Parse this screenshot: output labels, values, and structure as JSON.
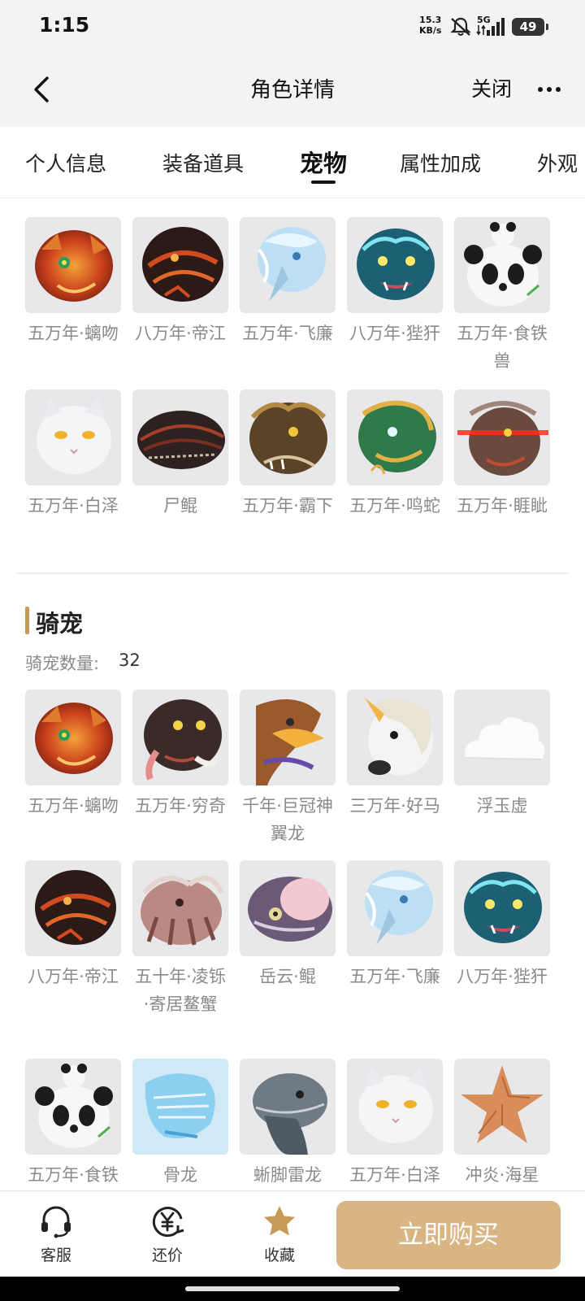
{
  "status_bar": {
    "time": "1:15",
    "net_speed_value": "15.3",
    "net_speed_unit": "KB/s",
    "network": "5G",
    "battery": "49"
  },
  "nav": {
    "title": "角色详情",
    "close": "关闭"
  },
  "tabs": [
    "个人信息",
    "装备道具",
    "宠物",
    "属性加成",
    "外观"
  ],
  "active_tab": "宠物",
  "pets": [
    {
      "name": "五万年·螭吻",
      "icon": "fire-dragon-head"
    },
    {
      "name": "八万年·帝江",
      "icon": "dark-lava-beast"
    },
    {
      "name": "五万年·飞廉",
      "icon": "ice-bird-head"
    },
    {
      "name": "八万年·狴犴",
      "icon": "blue-tiger-head"
    },
    {
      "name": "五万年·食铁兽",
      "icon": "panda-head"
    },
    {
      "name": "五万年·白泽",
      "icon": "white-cat-head"
    },
    {
      "name": "尸鲲",
      "icon": "dark-fish-head"
    },
    {
      "name": "五万年·霸下",
      "icon": "brown-beast-head"
    },
    {
      "name": "五万年·鸣蛇",
      "icon": "green-dragon-head"
    },
    {
      "name": "五万年·睚眦",
      "icon": "red-laser-dragon"
    }
  ],
  "mounts_section": {
    "title": "骑宠",
    "count_label": "骑宠数量:",
    "count": "32"
  },
  "mounts": [
    {
      "name": "五万年·螭吻",
      "icon": "fire-dragon-head"
    },
    {
      "name": "五万年·穷奇",
      "icon": "tusk-beast-head"
    },
    {
      "name": "千年·巨冠神翼龙",
      "icon": "pterosaur-head"
    },
    {
      "name": "三万年·好马",
      "icon": "unicorn-head"
    },
    {
      "name": "浮玉虚",
      "icon": "white-cloud"
    },
    {
      "name": "八万年·帝江",
      "icon": "dark-lava-beast"
    },
    {
      "name": "五十年·凌铄·寄居鳌蟹",
      "icon": "crab-head"
    },
    {
      "name": "岳云·鲲",
      "icon": "pink-fish-head"
    },
    {
      "name": "五万年·飞廉",
      "icon": "ice-bird-head"
    },
    {
      "name": "八万年·狴犴",
      "icon": "blue-tiger-head"
    },
    {
      "name": "五万年·食铁兽",
      "icon": "panda-head"
    },
    {
      "name": "骨龙",
      "icon": "blue-bone-dragon"
    },
    {
      "name": "蜥脚雷龙",
      "icon": "sauropod-head"
    },
    {
      "name": "五万年·白泽",
      "icon": "white-cat-head"
    },
    {
      "name": "冲炎·海星",
      "icon": "starfish"
    }
  ],
  "bottom_bar": {
    "service": "客服",
    "bargain": "还价",
    "favorite": "收藏",
    "buy": "立即购买"
  },
  "colors": {
    "accent": "#d9b583",
    "section_bar": "#c89a58",
    "favorite_star": "#c89a58",
    "thumb_bg": "#e8e8ea"
  }
}
